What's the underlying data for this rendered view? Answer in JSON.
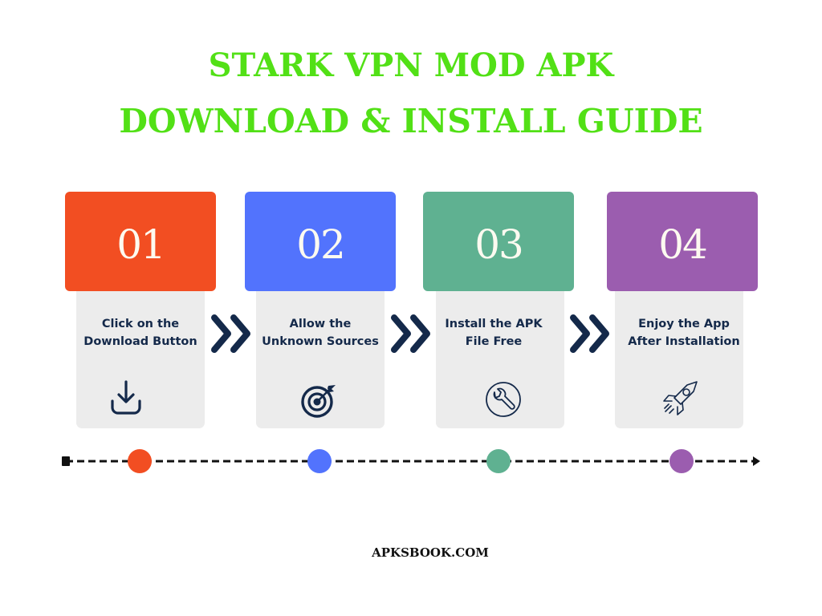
{
  "title": {
    "line1": "STARK VPN MOD APK",
    "line2": "DOWNLOAD & INSTALL GUIDE",
    "color": "#52e016"
  },
  "steps": [
    {
      "number": "01",
      "label_line1": "Click on the",
      "label_line2": "Download Button",
      "icon": "download-icon",
      "color": "#f24e22"
    },
    {
      "number": "02",
      "label_line1": "Allow the",
      "label_line2": "Unknown Sources",
      "icon": "target-icon",
      "color": "#5273fd"
    },
    {
      "number": "03",
      "label_line1": "Install the APK",
      "label_line2": "File Free",
      "icon": "wrench-icon",
      "color": "#5fb191"
    },
    {
      "number": "04",
      "label_line1": "Enjoy the App",
      "label_line2": "After Installation",
      "icon": "rocket-icon",
      "color": "#9b5daf"
    }
  ],
  "footer": {
    "text": "APKSBOOK.COM"
  }
}
